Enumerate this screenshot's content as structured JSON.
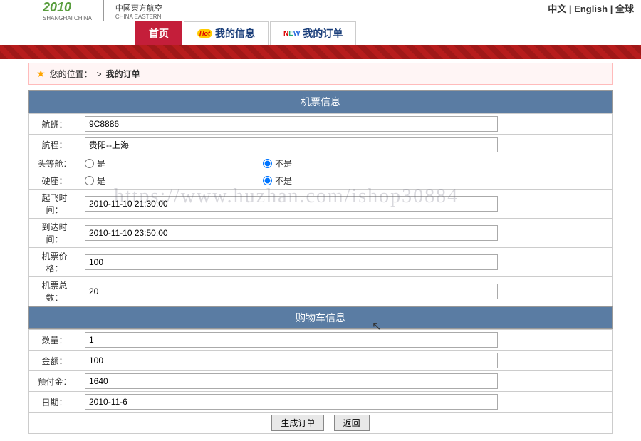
{
  "header": {
    "logo_main": "2010",
    "logo_sub": "SHANGHAI CHINA",
    "logo_ce": "中國東方航空",
    "logo_ce_sub": "CHINA EASTERN",
    "lang_zh": "中文",
    "lang_en": "English",
    "lang_global": "全球"
  },
  "nav": {
    "tabs": [
      {
        "label": "首页",
        "active": true
      },
      {
        "label": "我的信息",
        "badge": "Hot"
      },
      {
        "label": "我的订单",
        "badge": "NEW"
      }
    ]
  },
  "breadcrumb": {
    "prefix": "您的位置：",
    "sep": ">",
    "current": "我的订单"
  },
  "sections": {
    "ticket": {
      "title": "机票信息",
      "fields": {
        "flight_no": {
          "label": "航班：",
          "value": "9C8886"
        },
        "route": {
          "label": "航程：",
          "value": "贵阳--上海"
        },
        "first_class": {
          "label": "头等舱：",
          "yes": "是",
          "no": "不是",
          "selected": "no"
        },
        "hard_seat": {
          "label": "硬座：",
          "yes": "是",
          "no": "不是",
          "selected": "no"
        },
        "depart_time": {
          "label": "起飞时间：",
          "value": "2010-11-10 21:30:00"
        },
        "arrive_time": {
          "label": "到达时间：",
          "value": "2010-11-10 23:50:00"
        },
        "price": {
          "label": "机票价格：",
          "value": "100"
        },
        "total": {
          "label": "机票总数：",
          "value": "20"
        }
      }
    },
    "cart": {
      "title": "购物车信息",
      "fields": {
        "qty": {
          "label": "数量：",
          "value": "1"
        },
        "amount": {
          "label": "金额：",
          "value": "100"
        },
        "deposit": {
          "label": "预付金：",
          "value": "1640"
        },
        "date": {
          "label": "日期：",
          "value": "2010-11-6"
        }
      }
    }
  },
  "buttons": {
    "submit": "生成订单",
    "back": "返回"
  },
  "watermark": "https://www.huzhan.com/ishop30884"
}
